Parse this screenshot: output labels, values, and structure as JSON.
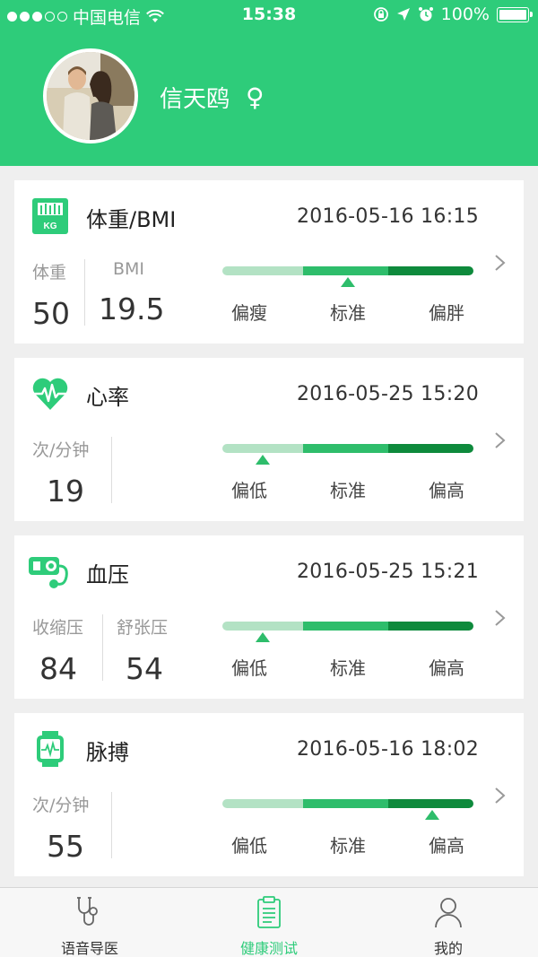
{
  "status_bar": {
    "carrier": "中国电信",
    "time": "15:38",
    "battery": "100%",
    "icons": [
      "signal-dots",
      "wifi-icon",
      "rotation-lock-icon",
      "location-icon",
      "alarm-icon",
      "battery-icon"
    ]
  },
  "profile": {
    "name": "信天鸥",
    "gender_symbol": "♀"
  },
  "cards": [
    {
      "title": "体重/BMI",
      "time": "2016-05-16 16:15",
      "icon": "scale-kg-icon",
      "icon_text": "KG",
      "metrics": [
        {
          "label": "体重",
          "value": "50"
        },
        {
          "label": "BMI",
          "value": "19.5"
        }
      ],
      "gauge_labels": [
        "偏瘦",
        "标准",
        "偏胖"
      ],
      "level": "标准"
    },
    {
      "title": "心率",
      "time": "2016-05-25 15:20",
      "icon": "heart-pulse-icon",
      "metrics": [
        {
          "label": "次/分钟",
          "value": "19"
        }
      ],
      "gauge_labels": [
        "偏低",
        "标准",
        "偏高"
      ],
      "level": "偏低"
    },
    {
      "title": "血压",
      "time": "2016-05-25 15:21",
      "icon": "blood-pressure-cuff-icon",
      "metrics": [
        {
          "label": "收缩压",
          "value": "84"
        },
        {
          "label": "舒张压",
          "value": "54"
        }
      ],
      "gauge_labels": [
        "偏低",
        "标准",
        "偏高"
      ],
      "level": "偏低"
    },
    {
      "title": "脉搏",
      "time": "2016-05-16 18:02",
      "icon": "smartwatch-pulse-icon",
      "metrics": [
        {
          "label": "次/分钟",
          "value": "55"
        }
      ],
      "gauge_labels": [
        "偏低",
        "标准",
        "偏高"
      ],
      "level": "偏高"
    }
  ],
  "tabbar": {
    "tabs": [
      {
        "label": "语音导医",
        "icon": "stethoscope-icon",
        "active": false
      },
      {
        "label": "健康测试",
        "icon": "clipboard-icon",
        "active": true
      },
      {
        "label": "我的",
        "icon": "person-icon",
        "active": false
      }
    ]
  },
  "colors": {
    "brand_green": "#2ecc7a",
    "gauge_light": "#b3e2c4",
    "gauge_mid": "#2ebd6b",
    "gauge_dark": "#0e8a3c"
  }
}
